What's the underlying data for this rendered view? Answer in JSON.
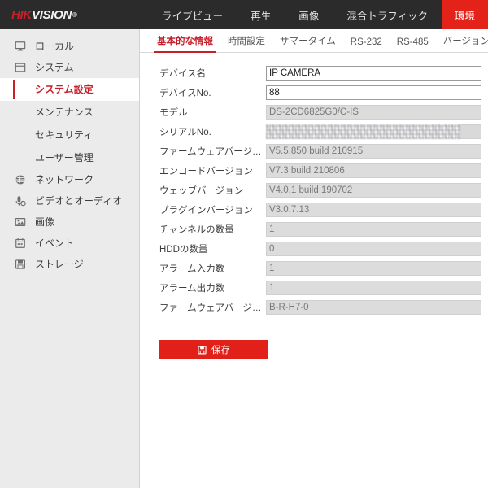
{
  "topbar": {
    "logo_primary": "HIK",
    "logo_secondary": "VISION",
    "logo_registered": "®",
    "nav": [
      {
        "label": "ライブビュー",
        "active": false
      },
      {
        "label": "再生",
        "active": false
      },
      {
        "label": "画像",
        "active": false
      },
      {
        "label": "混合トラフィック",
        "active": false
      },
      {
        "label": "環境",
        "active": true
      }
    ]
  },
  "sidebar": {
    "items": [
      {
        "label": "ローカル",
        "icon": "monitor-icon",
        "level": "top",
        "active": false
      },
      {
        "label": "システム",
        "icon": "window-icon",
        "level": "top",
        "active": false
      },
      {
        "label": "システム設定",
        "icon": "",
        "level": "sub",
        "active": true
      },
      {
        "label": "メンテナンス",
        "icon": "",
        "level": "sub",
        "active": false
      },
      {
        "label": "セキュリティ",
        "icon": "",
        "level": "sub",
        "active": false
      },
      {
        "label": "ユーザー管理",
        "icon": "",
        "level": "sub",
        "active": false
      },
      {
        "label": "ネットワーク",
        "icon": "globe-icon",
        "level": "top",
        "active": false
      },
      {
        "label": "ビデオとオーディオ",
        "icon": "video-audio-icon",
        "level": "top",
        "active": false
      },
      {
        "label": "画像",
        "icon": "picture-icon",
        "level": "top",
        "active": false
      },
      {
        "label": "イベント",
        "icon": "calendar-icon",
        "level": "top",
        "active": false
      },
      {
        "label": "ストレージ",
        "icon": "floppy-icon",
        "level": "top",
        "active": false
      }
    ]
  },
  "content": {
    "tabs": [
      {
        "label": "基本的な情報",
        "active": true
      },
      {
        "label": "時間設定",
        "active": false
      },
      {
        "label": "サマータイム",
        "active": false
      },
      {
        "label": "RS-232",
        "active": false
      },
      {
        "label": "RS-485",
        "active": false
      },
      {
        "label": "バージョン情報",
        "active": false
      }
    ],
    "fields": [
      {
        "label": "デバイス名",
        "value": "IP CAMERA",
        "type": "editable"
      },
      {
        "label": "デバイスNo.",
        "value": "88",
        "type": "editable"
      },
      {
        "label": "モデル",
        "value": "DS-2CD6825G0/C-IS",
        "type": "readonly"
      },
      {
        "label": "シリアルNo.",
        "value": "",
        "type": "blurred"
      },
      {
        "label": "ファームウェアバージョン",
        "value": "V5.5.850 build 210915",
        "type": "readonly"
      },
      {
        "label": "エンコードバージョン",
        "value": "V7.3 build 210806",
        "type": "readonly"
      },
      {
        "label": "ウェッブバージョン",
        "value": "V4.0.1 build 190702",
        "type": "readonly"
      },
      {
        "label": "プラグインバージョン",
        "value": "V3.0.7.13",
        "type": "readonly"
      },
      {
        "label": "チャンネルの数量",
        "value": "1",
        "type": "readonly"
      },
      {
        "label": "HDDの数量",
        "value": "0",
        "type": "readonly"
      },
      {
        "label": "アラーム入力数",
        "value": "1",
        "type": "readonly"
      },
      {
        "label": "アラーム出力数",
        "value": "1",
        "type": "readonly"
      },
      {
        "label": "ファームウェアバージョ...",
        "value": "B-R-H7-0",
        "type": "readonly"
      }
    ],
    "save_label": "保存"
  },
  "colors": {
    "brand_red": "#c8202a",
    "tab_red": "#e32219",
    "topbar_bg": "#2b2b2b",
    "sidebar_bg": "#ebebeb"
  }
}
